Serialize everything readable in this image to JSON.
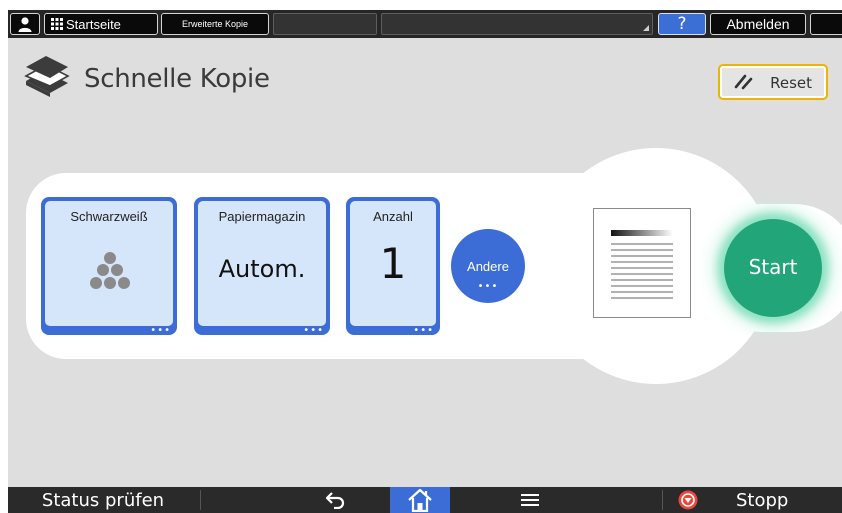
{
  "topbar": {
    "startseite_label": "Startseite",
    "erweiterte_kopie_label": "Erweiterte Kopie",
    "help_label": "?",
    "abmelden_label": "Abmelden"
  },
  "header": {
    "title": "Schnelle Kopie",
    "reset_label": "Reset"
  },
  "settings": {
    "color": {
      "label": "Schwarzweiß",
      "icon": "toner-dots-icon"
    },
    "paper": {
      "label": "Papiermagazin",
      "value": "Autom."
    },
    "count": {
      "label": "Anzahl",
      "value": "1"
    },
    "more": {
      "label": "Andere"
    }
  },
  "start": {
    "label": "Start"
  },
  "bottombar": {
    "status_label": "Status prüfen",
    "stop_label": "Stopp"
  },
  "colors": {
    "accent_blue": "#3c6dd6",
    "tile_fill": "#d6e6fa",
    "start_green": "#23a57a",
    "reset_border": "#f0b300",
    "stop_red": "#e8473c"
  }
}
